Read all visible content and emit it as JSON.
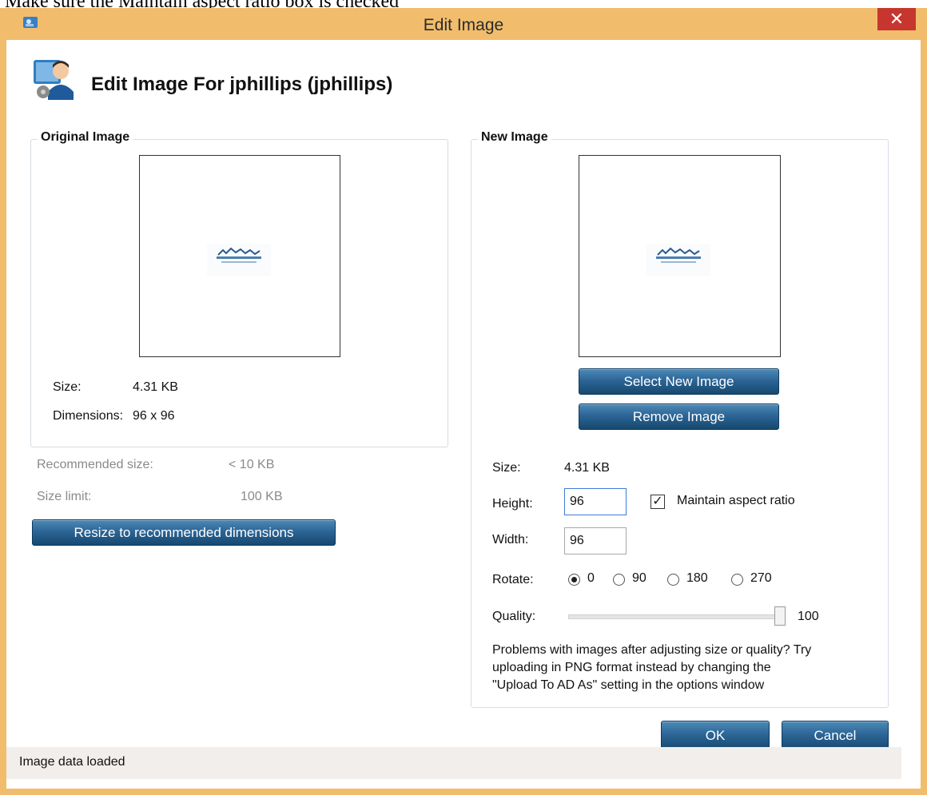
{
  "caption": "Make sure the Maintain aspect ratio box is checked",
  "window": {
    "title": "Edit Image",
    "close_glyph": "✕"
  },
  "header": {
    "title": "Edit Image For jphillips  (jphillips)",
    "icon": "user-image-icon"
  },
  "original": {
    "legend": "Original Image",
    "size_label": "Size:",
    "size_value": "4.31 KB",
    "dimensions_label": "Dimensions:",
    "dimensions_value": "96 x 96"
  },
  "limits": {
    "recommended_label": "Recommended size:",
    "recommended_value": "< 10 KB",
    "limit_label": "Size limit:",
    "limit_value": "100 KB",
    "resize_button": "Resize to recommended dimensions"
  },
  "new_image": {
    "legend": "New Image",
    "select_button": "Select New Image",
    "remove_button": "Remove Image",
    "size_label": "Size:",
    "size_value": "4.31 KB",
    "height_label": "Height:",
    "height_value": "96",
    "width_label": "Width:",
    "width_value": "96",
    "maintain_label": "Maintain aspect ratio",
    "maintain_checked": true,
    "check_glyph": "✓",
    "rotate_label": "Rotate:",
    "rotate_options": [
      "0",
      "90",
      "180",
      "270"
    ],
    "rotate_selected": "0",
    "quality_label": "Quality:",
    "quality_value": "100",
    "quality_fraction": 1.0,
    "note_line1": "Problems with images after adjusting size or quality? Try",
    "note_line2": "uploading in PNG format instead by changing the",
    "note_line3": "\"Upload To AD As\" setting in the options window"
  },
  "buttons": {
    "ok": "OK",
    "cancel": "Cancel"
  },
  "status": {
    "text": "Image data loaded"
  },
  "colors": {
    "button_blue": "#2c6596",
    "close_red": "#c7362e",
    "frame": "#f1bd6c"
  }
}
